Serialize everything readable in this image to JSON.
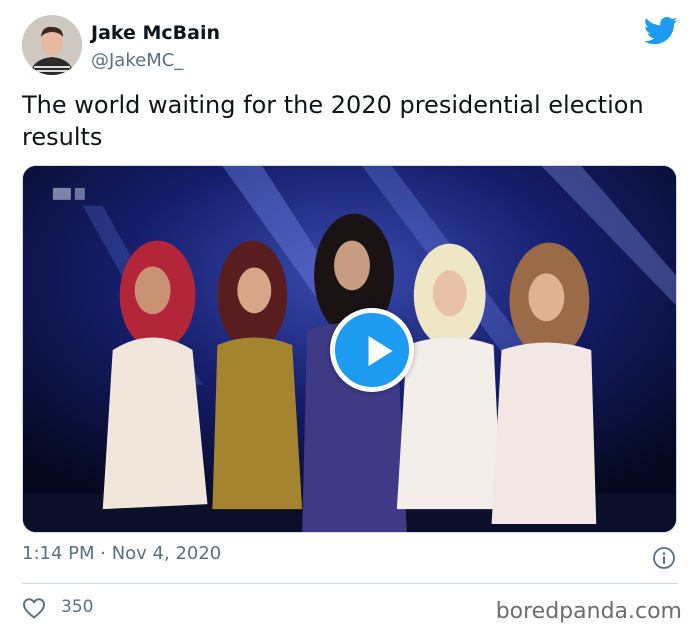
{
  "author": {
    "name": "Jake McBain",
    "handle": "@JakeMC_"
  },
  "tweet": {
    "text": "The world waiting for the 2020 presidential election results",
    "timestamp": "1:14 PM · Nov 4, 2020",
    "likes": "350"
  },
  "media": {
    "type": "video",
    "play_icon": "play-icon"
  },
  "icons": {
    "brand": "twitter-bird-icon",
    "info": "info-icon",
    "like": "heart-icon"
  },
  "watermark": "boredpanda.com",
  "colors": {
    "accent": "#1d9bf0",
    "secondary_text": "#5b7083",
    "text": "#0f1419"
  }
}
